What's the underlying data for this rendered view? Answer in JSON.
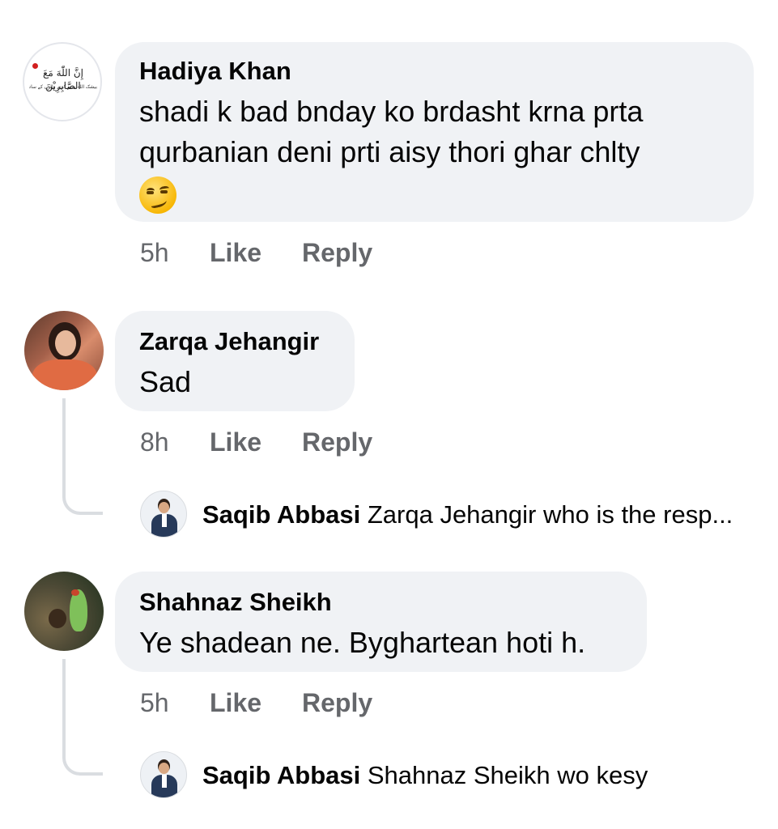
{
  "comments": [
    {
      "author": "Hadiya Khan",
      "text_lines": [
        "shadi k bad bnday ko brdasht krna prta",
        "qurbanian deni prti aisy thori ghar chlty"
      ],
      "emoji": "😏",
      "avatar_calligraphy": "إِنَّ اللّٰهَ مَعَ الصَّابِرِيْنَ",
      "avatar_subtitle": "بیشک اللہ صبر کرنے والوں کے ساتھ ہے",
      "time": "5h",
      "like_label": "Like",
      "reply_label": "Reply"
    },
    {
      "author": "Zarqa Jehangir",
      "text": "Sad",
      "time": "8h",
      "like_label": "Like",
      "reply_label": "Reply",
      "reply": {
        "author": "Saqib Abbasi",
        "text": "Zarqa Jehangir who is the resp..."
      }
    },
    {
      "author": "Shahnaz Sheikh",
      "text": "Ye shadean ne. Byghartean hoti h.",
      "time": "5h",
      "like_label": "Like",
      "reply_label": "Reply",
      "reply": {
        "author": "Saqib Abbasi",
        "text": "Shahnaz Sheikh wo kesy"
      }
    }
  ],
  "colors": {
    "bubble": "#f0f2f5",
    "meta_text": "#65676b",
    "thread_line": "#dadde1"
  }
}
